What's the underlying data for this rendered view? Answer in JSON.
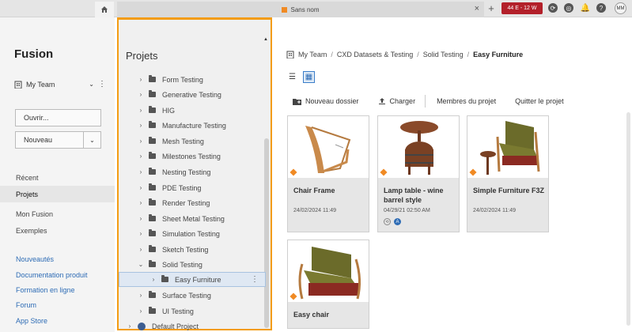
{
  "topbar": {
    "doc_tab_label": "Sans nom",
    "job_badge": "44 E - 12 W",
    "avatar_initials": "MM"
  },
  "sidebar": {
    "brand": "Fusion",
    "team_name": "My Team",
    "open_button": "Ouvrir...",
    "new_button": "Nouveau",
    "nav_items": [
      {
        "label": "Récent"
      },
      {
        "label": "Projets"
      },
      {
        "label": "Mon Fusion"
      },
      {
        "label": "Exemples"
      }
    ],
    "links": [
      {
        "label": "Nouveautés"
      },
      {
        "label": "Documentation produit"
      },
      {
        "label": "Formation en ligne"
      },
      {
        "label": "Forum"
      },
      {
        "label": "App Store"
      }
    ]
  },
  "projects_panel": {
    "title": "Projets",
    "tree": [
      {
        "label": "Form Testing"
      },
      {
        "label": "Generative Testing"
      },
      {
        "label": "HIG"
      },
      {
        "label": "Manufacture Testing"
      },
      {
        "label": "Mesh Testing"
      },
      {
        "label": "Milestones Testing"
      },
      {
        "label": "Nesting Testing"
      },
      {
        "label": "PDE Testing"
      },
      {
        "label": "Render Testing"
      },
      {
        "label": "Sheet Metal Testing"
      },
      {
        "label": "Simulation Testing"
      },
      {
        "label": "Sketch Testing"
      },
      {
        "label": "Solid Testing"
      },
      {
        "label": "Easy Furniture"
      },
      {
        "label": "Surface Testing"
      },
      {
        "label": "UI Testing"
      },
      {
        "label": "Default Project"
      }
    ]
  },
  "main": {
    "breadcrumbs": [
      "My Team",
      "CXD Datasets & Testing",
      "Solid Testing",
      "Easy Furniture"
    ],
    "actions": {
      "new_folder": "Nouveau dossier",
      "upload": "Charger",
      "members": "Membres du projet",
      "leave": "Quitter le projet"
    },
    "cards": [
      {
        "name": "Chair Frame",
        "date": "24/02/2024 11:49"
      },
      {
        "name": "Lamp table - wine barrel style",
        "date": "04/29/21 02:50 AM"
      },
      {
        "name": "Simple Furniture F3Z",
        "date": "24/02/2024 11:49"
      },
      {
        "name": "Easy chair",
        "date": ""
      }
    ]
  },
  "colors": {
    "accent": "#2e6cb5",
    "highlight_border": "#f39c12",
    "job_badge": "#b3202a"
  }
}
